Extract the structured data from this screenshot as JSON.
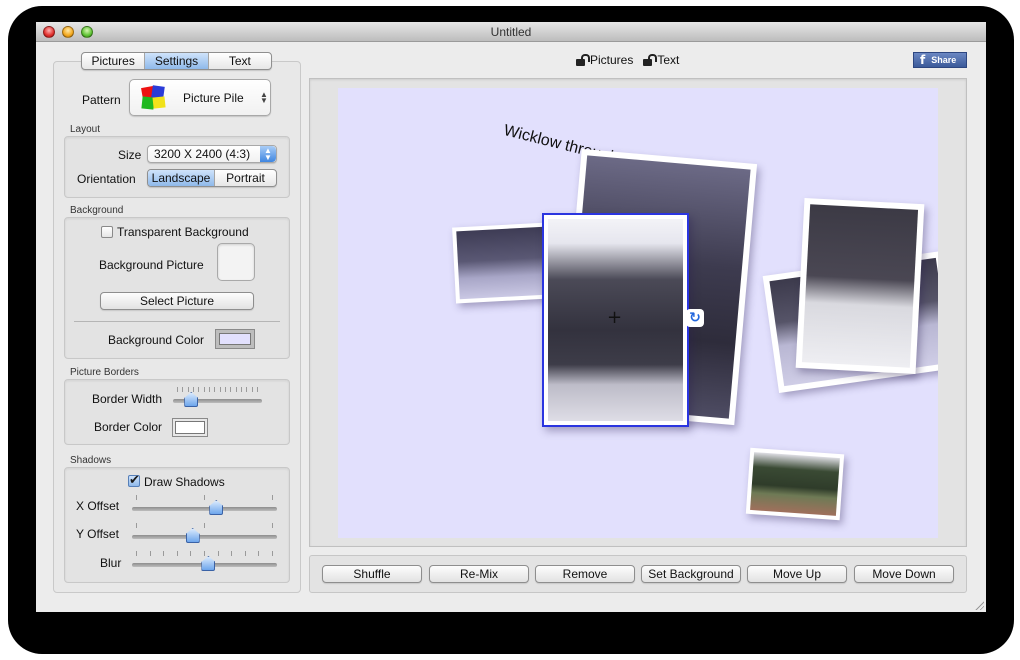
{
  "window": {
    "title": "Untitled"
  },
  "sidebar": {
    "tabs": [
      {
        "label": "Pictures",
        "selected": false
      },
      {
        "label": "Settings",
        "selected": true
      },
      {
        "label": "Text",
        "selected": false
      }
    ],
    "pattern": {
      "label": "Pattern",
      "value": "Picture Pile",
      "icon": "picture-pile-icon"
    },
    "layout": {
      "section": "Layout",
      "size_label": "Size",
      "size_value": "3200 X 2400 (4:3)",
      "orientation_label": "Orientation",
      "orientation_options": [
        {
          "label": "Landscape",
          "selected": true
        },
        {
          "label": "Portrait",
          "selected": false
        }
      ]
    },
    "background": {
      "section": "Background",
      "transparent_label": "Transparent Background",
      "transparent_checked": false,
      "picture_label": "Background Picture",
      "select_button": "Select Picture",
      "color_label": "Background Color",
      "color_value": "#e2e0fd"
    },
    "borders": {
      "section": "Picture Borders",
      "width_label": "Border Width",
      "width_value": 0.15,
      "color_label": "Border Color",
      "color_value": "#ffffff"
    },
    "shadows": {
      "section": "Shadows",
      "draw_label": "Draw Shadows",
      "draw_checked": true,
      "x_offset_label": "X Offset",
      "x_offset_value": 0.59,
      "y_offset_label": "Y Offset",
      "y_offset_value": 0.41,
      "blur_label": "Blur",
      "blur_value": 0.53
    }
  },
  "toolbar": {
    "locks": [
      {
        "label": "Pictures",
        "icon": "unlocked-icon"
      },
      {
        "label": "Text",
        "icon": "unlocked-icon"
      }
    ],
    "share_label": "Share"
  },
  "canvas": {
    "caption": "Wicklow through the winter",
    "background_color": "#e2e0fd",
    "selection_color": "#2b35e0"
  },
  "actions": [
    {
      "label": "Shuffle"
    },
    {
      "label": "Re-Mix"
    },
    {
      "label": "Remove"
    },
    {
      "label": "Set Background"
    },
    {
      "label": "Move Up"
    },
    {
      "label": "Move Down"
    }
  ]
}
